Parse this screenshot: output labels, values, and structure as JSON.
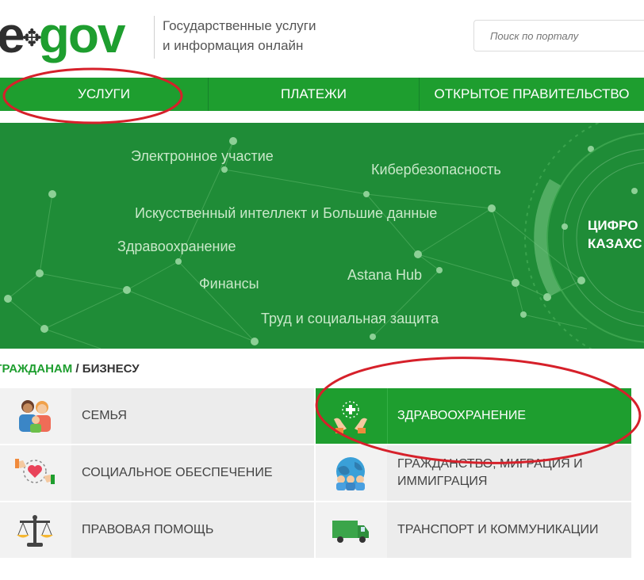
{
  "header": {
    "logo_e": "e",
    "logo_gov": "gov",
    "tagline_line1": "Государственные услуги",
    "tagline_line2": "и информация онлайн",
    "search_placeholder": "Поиск по порталу"
  },
  "nav": {
    "items": [
      {
        "label": "Услуги"
      },
      {
        "label": "Платежи"
      },
      {
        "label": "Открытое правительство"
      }
    ]
  },
  "banner": {
    "topics": [
      "Электронное участие",
      "Кибербезопасность",
      "Искусственный интеллект и Большие данные",
      "Здравоохранение",
      "Финансы",
      "Astana Hub",
      "Труд и социальная защита"
    ],
    "digital_line1": "ЦИФРО",
    "digital_line2": "КАЗАХС"
  },
  "breadcrumb": {
    "active": "Гражданам",
    "separator": " / ",
    "other": "Бизнесу"
  },
  "categories": [
    {
      "label": "Семья",
      "icon": "family-icon"
    },
    {
      "label": "Здравоохранение",
      "icon": "healthcare-hands-icon"
    },
    {
      "label": "Социальное обеспечение",
      "icon": "social-support-heart-icon"
    },
    {
      "label": "Гражданство, миграция и иммиграция",
      "icon": "citizenship-globe-icon"
    },
    {
      "label": "Правовая помощь",
      "icon": "legal-scales-icon"
    },
    {
      "label": "Транспорт и коммуникации",
      "icon": "truck-icon"
    }
  ],
  "colors": {
    "brand_green": "#1e9e2f",
    "banner_green": "#1f8c37",
    "annotation_red": "#d6202a"
  }
}
